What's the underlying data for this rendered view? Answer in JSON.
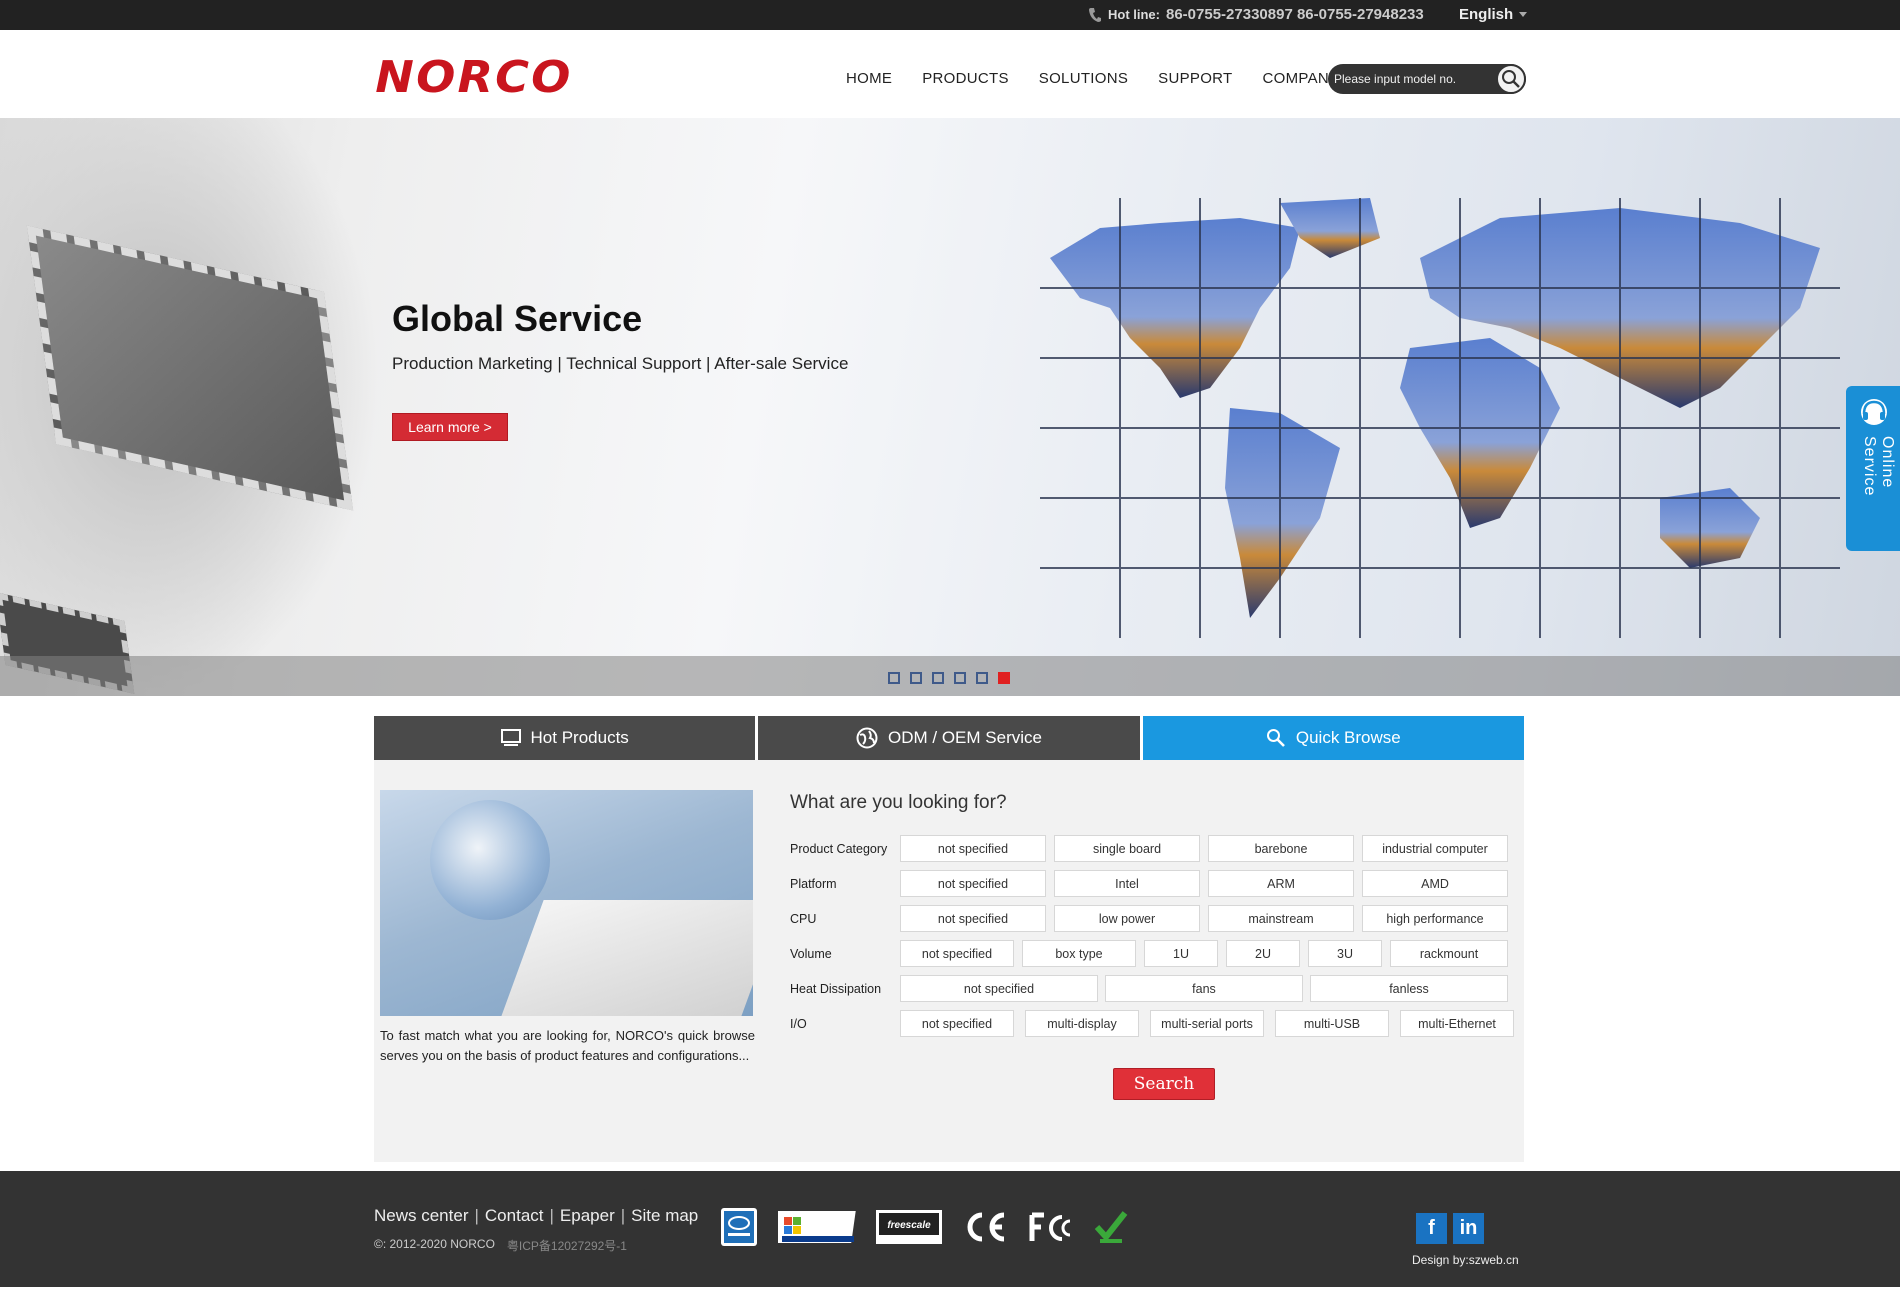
{
  "topbar": {
    "hotline_label": "Hot line:",
    "hotline_numbers": "86-0755-27330897 86-0755-27948233",
    "language": "English"
  },
  "header": {
    "logo": "NORCO",
    "nav": [
      "HOME",
      "PRODUCTS",
      "SOLUTIONS",
      "SUPPORT",
      "COMPANY"
    ],
    "search_placeholder": "Please input model no."
  },
  "hero": {
    "title": "Global Service",
    "subtitle": "Production Marketing | Technical Support | After-sale Service",
    "button": "Learn more  >",
    "slide_count": 6,
    "active_slide": 6
  },
  "online_service": {
    "label": "Online Service"
  },
  "tabs": [
    {
      "label": "Hot Products",
      "icon": "monitor-icon",
      "active": false
    },
    {
      "label": "ODM / OEM Service",
      "icon": "globe-icon",
      "active": false
    },
    {
      "label": "Quick Browse",
      "icon": "search-icon",
      "active": true
    }
  ],
  "quick_browse": {
    "description": "To fast match what you are looking for, NORCO's quick browse serves you on the basis of product features and configurations...",
    "question": "What are you looking for?",
    "rows": [
      {
        "label": "Product Category",
        "options": [
          "not specified",
          "single board",
          "barebone",
          "industrial computer"
        ]
      },
      {
        "label": "Platform",
        "options": [
          "not specified",
          "Intel",
          "ARM",
          "AMD"
        ]
      },
      {
        "label": "CPU",
        "options": [
          "not specified",
          "low power",
          "mainstream",
          "high performance"
        ]
      },
      {
        "label": "Volume",
        "options": [
          "not specified",
          "box type",
          "1U",
          "2U",
          "3U",
          "rackmount"
        ]
      },
      {
        "label": "Heat Dissipation",
        "options": [
          "not specified",
          "fans",
          "fanless"
        ]
      },
      {
        "label": "I/O",
        "options": [
          "not specified",
          "multi-display",
          "multi-serial ports",
          "multi-USB",
          "multi-Ethernet"
        ]
      }
    ],
    "search_button": "Search"
  },
  "footer": {
    "links": [
      "News center",
      "Contact",
      "Epaper",
      "Site map"
    ],
    "copyright": "©: 2012-2020 NORCO",
    "icp": "粤ICP备12027292号-1",
    "certifications": [
      "intel-iot-logo",
      "windows-embedded-logo",
      "freescale-logo",
      "ce-mark",
      "fcc-mark",
      "rohs-check"
    ],
    "social": [
      {
        "name": "facebook-icon",
        "text": "f"
      },
      {
        "name": "linkedin-icon",
        "text": "in"
      }
    ],
    "design_credit": "Design by:szweb.cn"
  },
  "colors": {
    "brand_red": "#c9151e",
    "accent_blue": "#1a98e0",
    "tab_dark": "#4a4a4a",
    "footer_bg": "#333333"
  }
}
